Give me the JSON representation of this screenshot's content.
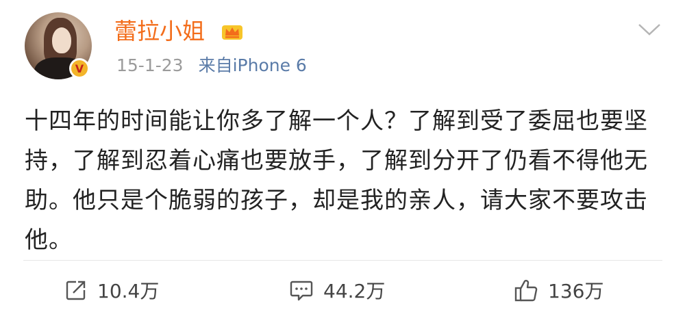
{
  "post": {
    "author": {
      "name": "蕾拉小姐",
      "avatar_icon": "avatar-portrait",
      "badge_icon": "verified-v-icon",
      "badge_text": "V",
      "membership_icon": "crown-icon"
    },
    "meta": {
      "date": "15-1-23",
      "source": "来自iPhone 6"
    },
    "menu_icon": "chevron-down-icon",
    "text": "十四年的时间能让你多了解一个人？了解到受了委屈也要坚持，了解到忍着心痛也要放手，了解到分开了仍看不得他无助。他只是个脆弱的孩子，却是我的亲人，请大家不要攻击他。",
    "actions": {
      "repost_count": "10.4万",
      "comment_count": "44.2万",
      "like_count": "136万"
    }
  },
  "colors": {
    "username": "#f36d1b",
    "meta_gray": "#9b9b9b",
    "source_blue": "#5a7ba8",
    "badge_gold": "#f3b42a",
    "badge_red": "#c4261b",
    "text": "#222222"
  }
}
